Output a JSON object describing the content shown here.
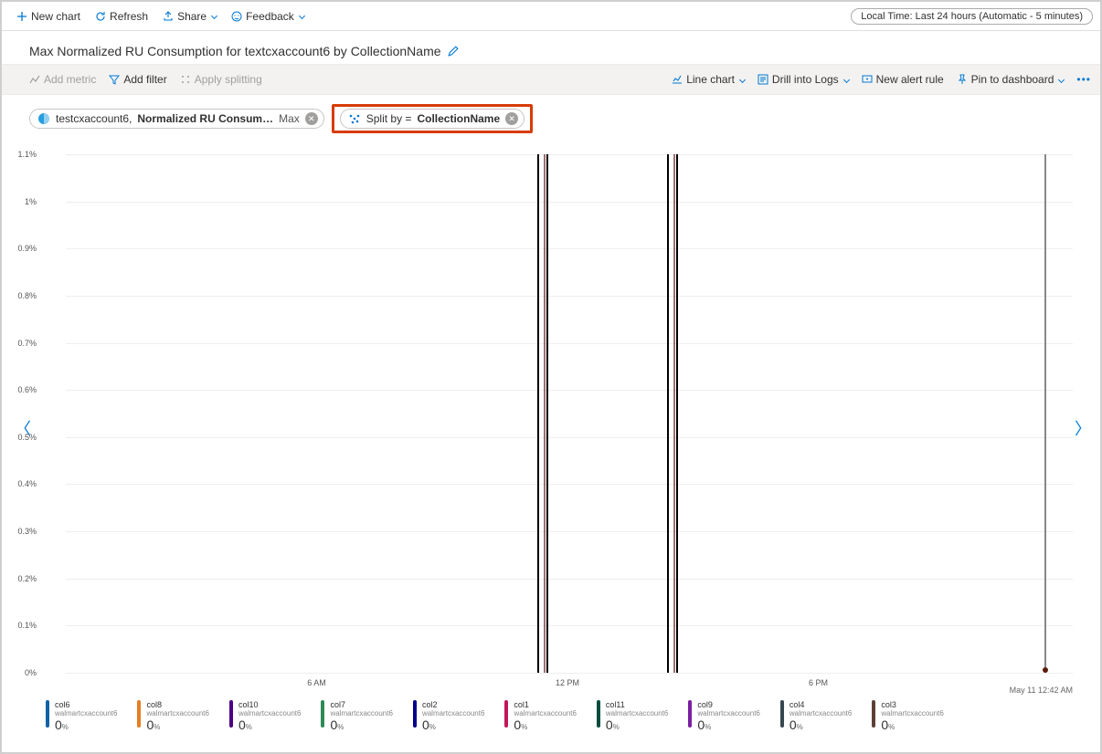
{
  "toolbar": {
    "new_chart": "New chart",
    "refresh": "Refresh",
    "share": "Share",
    "feedback": "Feedback",
    "time_pill": "Local Time: Last 24 hours (Automatic - 5 minutes)"
  },
  "chart_title": "Max Normalized RU Consumption for textcxaccount6 by CollectionName",
  "chart_toolbar": {
    "add_metric": "Add metric",
    "add_filter": "Add filter",
    "apply_splitting": "Apply splitting",
    "line_chart": "Line chart",
    "drill_logs": "Drill into Logs",
    "new_alert": "New alert rule",
    "pin_dashboard": "Pin to dashboard"
  },
  "pills": {
    "metric_account": "testcxaccount6,",
    "metric_name": "Normalized RU Consum…",
    "metric_agg": "Max",
    "split_prefix": "Split by =",
    "split_value": "CollectionName"
  },
  "footer_time": "May 11 12:42 AM",
  "chart_data": {
    "type": "line",
    "title": "Max Normalized RU Consumption for textcxaccount6 by CollectionName",
    "ylabel": "Normalized RU Consumption",
    "ylim": [
      0,
      1.1
    ],
    "y_format": "percent",
    "y_ticks": [
      "0%",
      "0.1%",
      "0.2%",
      "0.3%",
      "0.4%",
      "0.5%",
      "0.6%",
      "0.7%",
      "0.8%",
      "0.9%",
      "1%",
      "1.1%"
    ],
    "x_range_hours": [
      0,
      24
    ],
    "x_ticks": [
      {
        "label": "6 AM",
        "pos": 0.25
      },
      {
        "label": "12 PM",
        "pos": 0.5
      },
      {
        "label": "6 PM",
        "pos": 0.75
      }
    ],
    "spikes_pos": [
      0.475,
      0.605
    ],
    "spike_description": "Two narrow spikes from 0% to 1% near 11 AM and 2 PM; all other series remain at 0%.",
    "cursor_pos": 0.975,
    "series": [
      {
        "name": "col6",
        "sub": "walmartcxaccount6",
        "value": 0,
        "unit": "%",
        "color": "#1062a4"
      },
      {
        "name": "col8",
        "sub": "walmartcxaccount6",
        "value": 0,
        "unit": "%",
        "color": "#e67e22"
      },
      {
        "name": "col10",
        "sub": "walmartcxaccount6",
        "value": 0,
        "unit": "%",
        "color": "#4b0082"
      },
      {
        "name": "col7",
        "sub": "walmartcxaccount6",
        "value": 0,
        "unit": "%",
        "color": "#2e8b57"
      },
      {
        "name": "col2",
        "sub": "walmartcxaccount6",
        "value": 0,
        "unit": "%",
        "color": "#00008b"
      },
      {
        "name": "col1",
        "sub": "walmartcxaccount6",
        "value": 0,
        "unit": "%",
        "color": "#c2185b"
      },
      {
        "name": "col11",
        "sub": "walmartcxaccount6",
        "value": 0,
        "unit": "%",
        "color": "#004d40"
      },
      {
        "name": "col9",
        "sub": "walmartcxaccount6",
        "value": 0,
        "unit": "%",
        "color": "#7b1fa2"
      },
      {
        "name": "col4",
        "sub": "walmartcxaccount6",
        "value": 0,
        "unit": "%",
        "color": "#37474f"
      },
      {
        "name": "col3",
        "sub": "walmartcxaccount6",
        "value": 0,
        "unit": "%",
        "color": "#5d4037"
      }
    ]
  }
}
